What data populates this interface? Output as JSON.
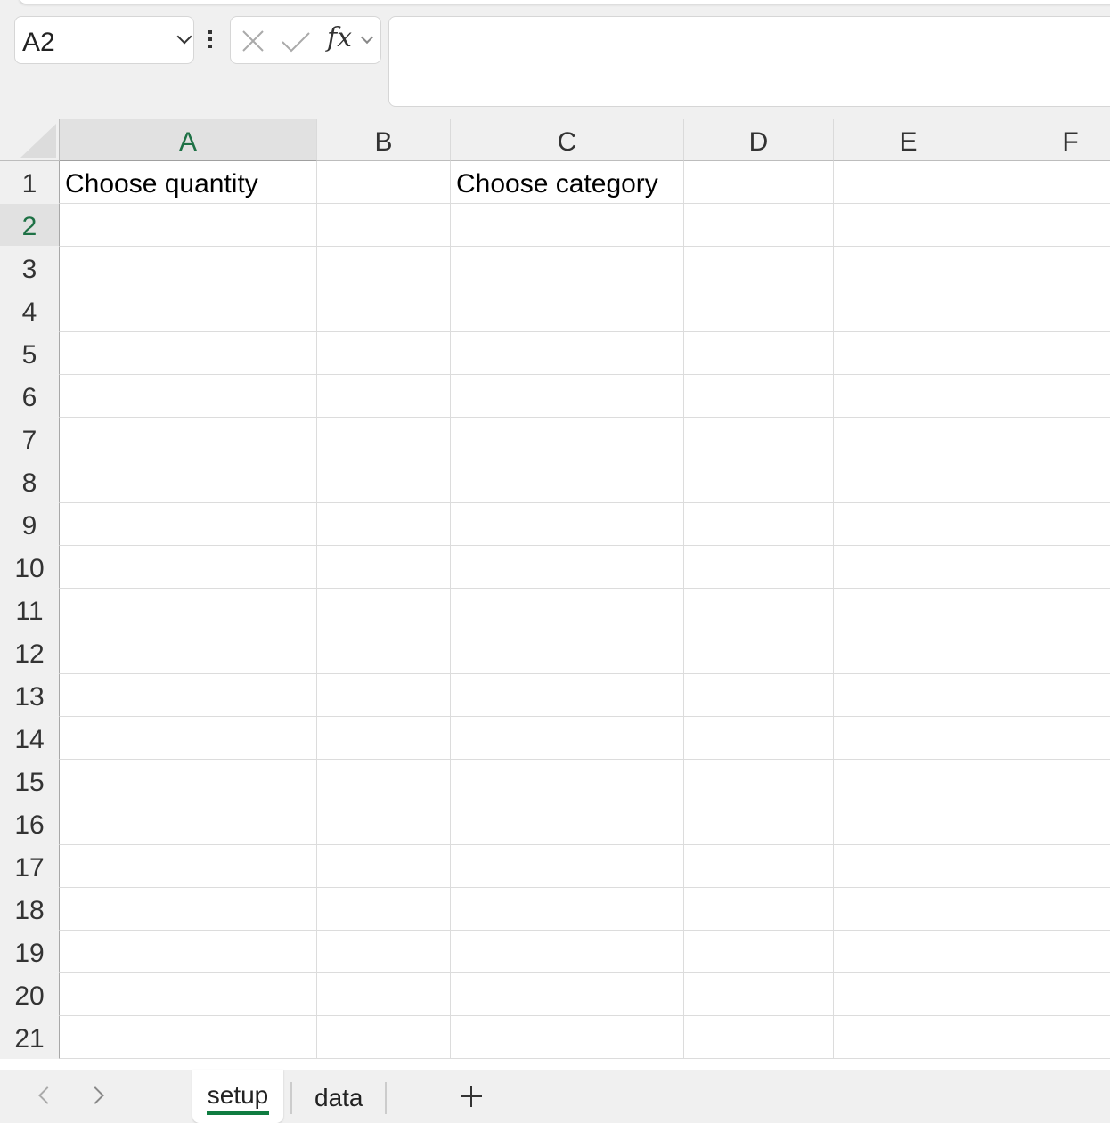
{
  "name_box": {
    "value": "A2"
  },
  "formula_bar": {
    "fx_label": "fx",
    "value": ""
  },
  "columns": [
    "A",
    "B",
    "C",
    "D",
    "E",
    "F"
  ],
  "selected_column": "A",
  "selected_row": 2,
  "rows": [
    1,
    2,
    3,
    4,
    5,
    6,
    7,
    8,
    9,
    10,
    11,
    12,
    13,
    14,
    15,
    16,
    17,
    18,
    19,
    20,
    21
  ],
  "cells": {
    "A1": "Choose quantity",
    "C1": "Choose category"
  },
  "sheet_tabs": [
    {
      "label": "setup",
      "active": true
    },
    {
      "label": "data",
      "active": false
    }
  ],
  "accent_color": "#107c41"
}
